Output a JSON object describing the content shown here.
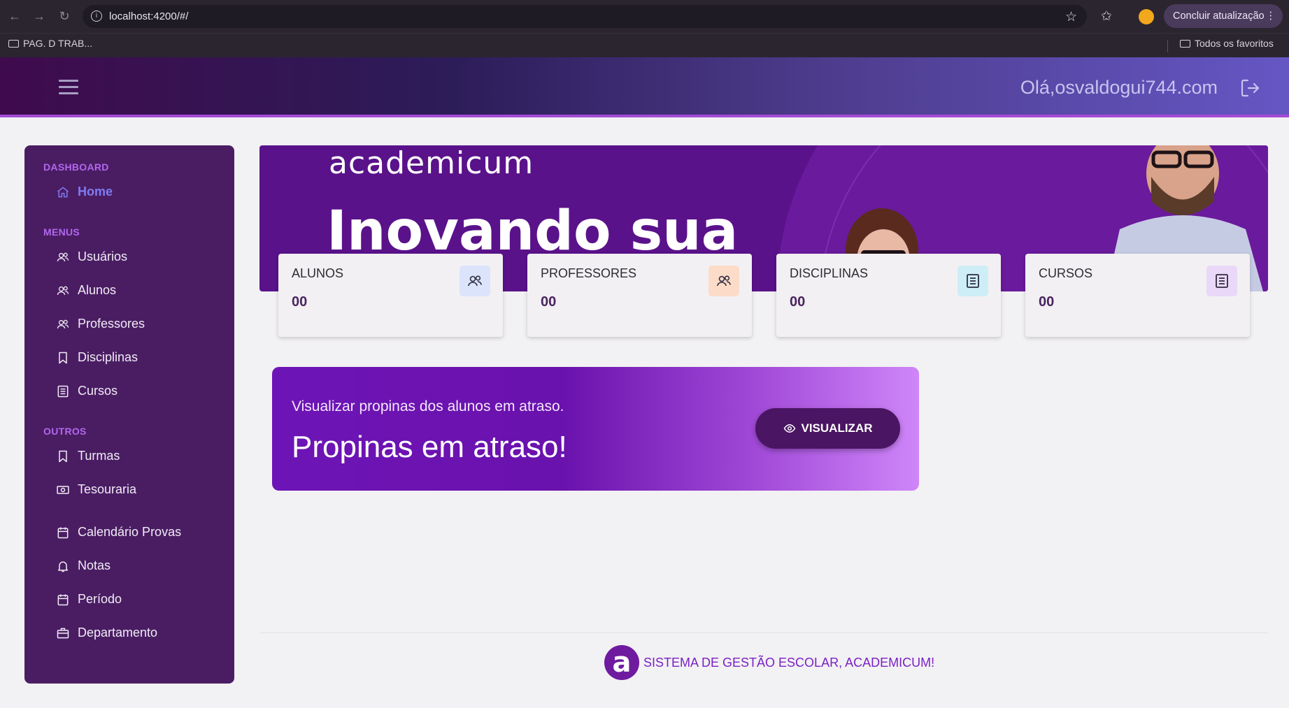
{
  "browser": {
    "url": "localhost:4200/#/",
    "update_button": "Concluir atualização",
    "bookmarks": [
      {
        "label": "PAG. D TRAB..."
      },
      {
        "label": "Todos os favoritos"
      }
    ]
  },
  "header": {
    "greeting": "Olá,osvaldogui744.com"
  },
  "sidebar": {
    "sections": [
      {
        "title": "DASHBOARD",
        "items": [
          {
            "label": "Home",
            "icon": "home-icon"
          }
        ]
      },
      {
        "title": "MENUS",
        "items": [
          {
            "label": "Usuários",
            "icon": "users-icon"
          },
          {
            "label": "Alunos",
            "icon": "users-icon"
          },
          {
            "label": "Professores",
            "icon": "users-icon"
          },
          {
            "label": "Disciplinas",
            "icon": "bookmark-icon"
          },
          {
            "label": "Cursos",
            "icon": "document-icon"
          }
        ]
      },
      {
        "title": "OUTROS",
        "items": [
          {
            "label": "Turmas",
            "icon": "bookmark-icon"
          },
          {
            "label": "Tesouraria",
            "icon": "cash-icon"
          },
          {
            "label": "Calendário Provas",
            "icon": "calendar-icon"
          },
          {
            "label": "Notas",
            "icon": "bell-icon"
          },
          {
            "label": "Período",
            "icon": "calendar-icon"
          },
          {
            "label": "Departamento",
            "icon": "briefcase-icon"
          }
        ]
      }
    ]
  },
  "banner": {
    "logo_text": "academicum",
    "headline": "Inovando sua"
  },
  "stats": [
    {
      "label": "ALUNOS",
      "value": "00",
      "icon": "users-icon",
      "icon_bg": "#dbe4fb"
    },
    {
      "label": "PROFESSORES",
      "value": "00",
      "icon": "users-icon",
      "icon_bg": "#fcdcc8"
    },
    {
      "label": "DISCIPLINAS",
      "value": "00",
      "icon": "document-icon",
      "icon_bg": "#cdeef6"
    },
    {
      "label": "CURSOS",
      "value": "00",
      "icon": "document-icon",
      "icon_bg": "#ead8f8"
    }
  ],
  "promo": {
    "subtitle": "Visualizar propinas dos alunos em atraso.",
    "title": "Propinas em atraso!",
    "button_label": "VISUALIZAR"
  },
  "footer": {
    "logo_letter": "a",
    "text": "SISTEMA DE GESTÃO ESCOLAR, ACADEMICUM!"
  },
  "colors": {
    "sidebar_bg": "#4a1d63",
    "accent": "#b267ee",
    "brand_purple": "#6d14b6"
  }
}
